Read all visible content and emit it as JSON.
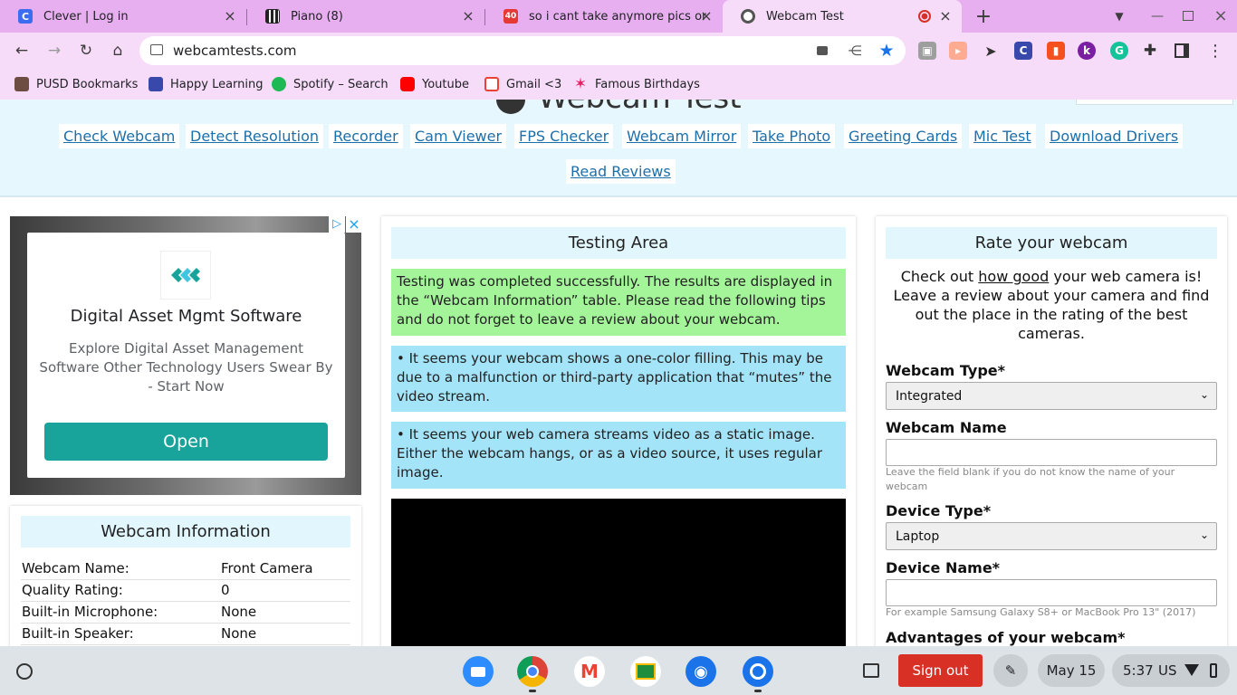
{
  "browser": {
    "tabs": [
      {
        "title": "Clever | Log in",
        "favicon_color": "#3c6df0",
        "favicon_letter": "C"
      },
      {
        "title": "Piano (8)",
        "favicon_color": "#222222",
        "favicon_letter": "▮"
      },
      {
        "title": "so i cant take anymore pics on m",
        "favicon_color": "#e53935",
        "favicon_letter": "40"
      },
      {
        "title": "Webcam Test",
        "favicon_color": "#555555",
        "favicon_letter": "●",
        "active": true
      }
    ],
    "new_tab_label": "+",
    "url": "webcamtests.com",
    "bookmarks": [
      {
        "label": "PUSD Bookmarks",
        "icon_color": "#6d4c41"
      },
      {
        "label": "Happy Learning",
        "icon_color": "#3949ab"
      },
      {
        "label": "Spotify – Search",
        "icon_color": "#1db954"
      },
      {
        "label": "Youtube",
        "icon_color": "#ff0000"
      },
      {
        "label": "Gmail <3",
        "icon_color": "#ea4335"
      },
      {
        "label": "Famous Birthdays",
        "icon_color": "#e91e63"
      }
    ]
  },
  "site": {
    "title": "Webcam Test",
    "nav": [
      "Check Webcam",
      "Detect Resolution",
      "Recorder",
      "Cam Viewer",
      "FPS Checker",
      "Webcam Mirror",
      "Take Photo",
      "Greeting Cards",
      "Mic Test",
      "Download Drivers",
      "Read Reviews"
    ]
  },
  "ad": {
    "title": "Digital Asset Mgmt Software",
    "text": "Explore Digital Asset Management Software Other Technology Users Swear By - Start Now",
    "button": "Open",
    "brand_color": "#18a39b"
  },
  "webcam_info": {
    "header": "Webcam Information",
    "rows": [
      {
        "k": "Webcam Name:",
        "v": "Front Camera"
      },
      {
        "k": "Quality Rating:",
        "v": "0"
      },
      {
        "k": "Built-in Microphone:",
        "v": "None"
      },
      {
        "k": "Built-in Speaker:",
        "v": "None"
      }
    ]
  },
  "testing": {
    "header": "Testing Area",
    "success": "Testing was completed successfully. The results are displayed in the “Webcam Information” table. Please read the following tips and do not forget to leave a review about your webcam.",
    "tip1": "• It seems your webcam shows a one-color filling. This may be due to a malfunction or third-party application that “mutes” the video stream.",
    "tip2": "• It seems your web camera streams video as a static image. Either the webcam hangs, or as a video source, it uses regular image.",
    "success_color": "#a4f49a",
    "tip_color": "#a3e4f8"
  },
  "rate": {
    "header": "Rate your webcam",
    "intro_before": "Check out ",
    "intro_link": "how good",
    "intro_after": " your web camera is! Leave a review about your camera and find out the place in the rating of the best cameras.",
    "webcam_type_label": "Webcam Type*",
    "webcam_type_value": "Integrated",
    "webcam_name_label": "Webcam Name",
    "webcam_name_value": "",
    "webcam_name_hint": "Leave the field blank if you do not know the name of your webcam",
    "device_type_label": "Device Type*",
    "device_type_value": "Laptop",
    "device_name_label": "Device Name*",
    "device_name_value": "",
    "device_name_hint": "For example Samsung Galaxy S8+ or MacBook Pro 13\" (2017)",
    "advantages_label": "Advantages of your webcam*"
  },
  "shelf": {
    "sign_out": "Sign out",
    "date": "May 15",
    "time": "5:37",
    "locale": "US",
    "sign_out_color": "#d93025"
  }
}
